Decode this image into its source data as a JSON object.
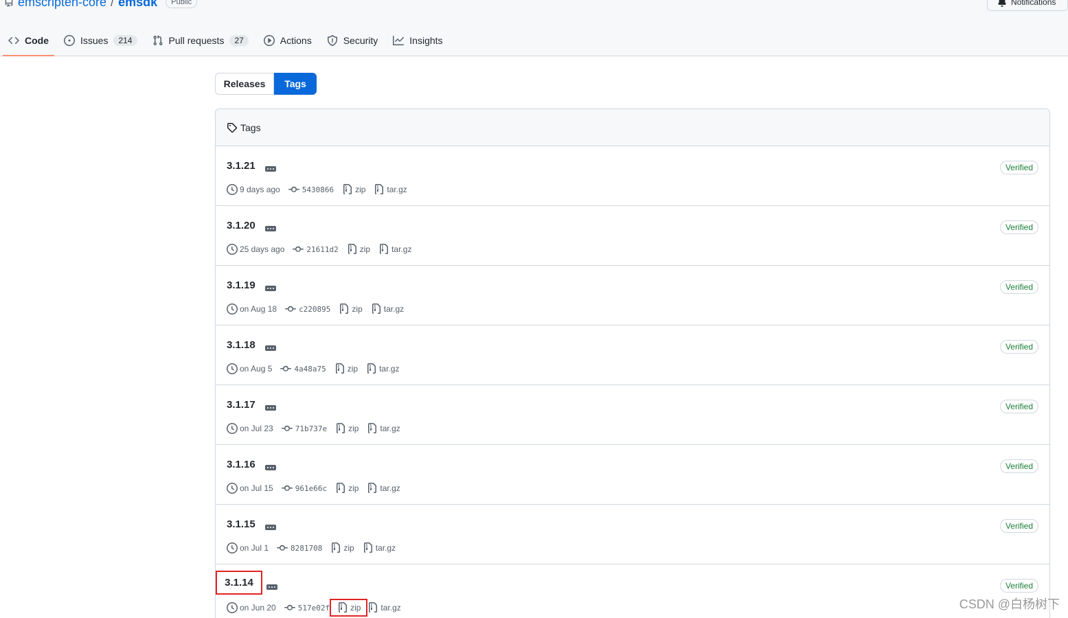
{
  "repo": {
    "owner": "emscripten-core",
    "separator": "/",
    "name": "emsdk",
    "visibility": "Public",
    "notifications_label": "Notifications"
  },
  "tabs": [
    {
      "label": "Code",
      "icon": "code-icon",
      "selected": true
    },
    {
      "label": "Issues",
      "icon": "issue-icon",
      "count": "214"
    },
    {
      "label": "Pull requests",
      "icon": "pull-request-icon",
      "count": "27"
    },
    {
      "label": "Actions",
      "icon": "play-icon"
    },
    {
      "label": "Security",
      "icon": "shield-icon"
    },
    {
      "label": "Insights",
      "icon": "graph-icon"
    }
  ],
  "segmented": {
    "releases": "Releases",
    "tags": "Tags",
    "selected": "Tags"
  },
  "tags_header": "Tags",
  "tags": [
    {
      "name": "3.1.21",
      "date": "9 days ago",
      "sha": "5430866",
      "zip": "zip",
      "targz": "tar.gz",
      "verified": "Verified"
    },
    {
      "name": "3.1.20",
      "date": "25 days ago",
      "sha": "21611d2",
      "zip": "zip",
      "targz": "tar.gz",
      "verified": "Verified"
    },
    {
      "name": "3.1.19",
      "date": "on Aug 18",
      "sha": "c220895",
      "zip": "zip",
      "targz": "tar.gz",
      "verified": "Verified"
    },
    {
      "name": "3.1.18",
      "date": "on Aug 5",
      "sha": "4a48a75",
      "zip": "zip",
      "targz": "tar.gz",
      "verified": "Verified"
    },
    {
      "name": "3.1.17",
      "date": "on Jul 23",
      "sha": "71b737e",
      "zip": "zip",
      "targz": "tar.gz",
      "verified": "Verified"
    },
    {
      "name": "3.1.16",
      "date": "on Jul 15",
      "sha": "961e66c",
      "zip": "zip",
      "targz": "tar.gz",
      "verified": "Verified"
    },
    {
      "name": "3.1.15",
      "date": "on Jul 1",
      "sha": "8281708",
      "zip": "zip",
      "targz": "tar.gz",
      "verified": "Verified"
    },
    {
      "name": "3.1.14",
      "date": "on Jun 20",
      "sha": "517e02f",
      "zip": "zip",
      "targz": "tar.gz",
      "verified": "Verified"
    }
  ],
  "colors": {
    "accent": "#0969da",
    "verified": "#1a7f37",
    "highlight_box": "#e02424",
    "selected_tab_underline": "#fd8c73"
  },
  "watermark": "CSDN @白杨树下"
}
